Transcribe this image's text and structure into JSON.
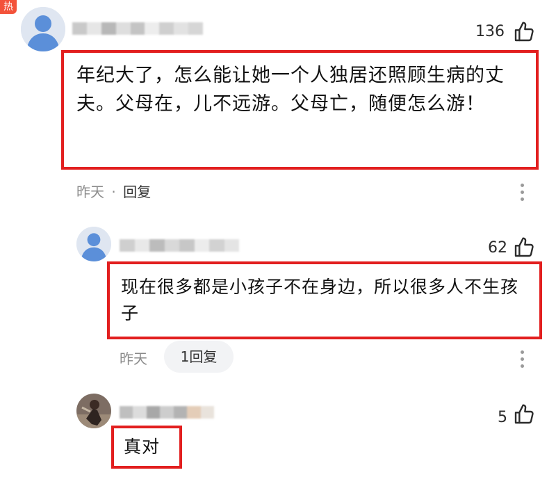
{
  "badge": {
    "label": "热"
  },
  "comments": [
    {
      "likes": "136",
      "text": "年纪大了，怎么能让她一个人独居还照顾生病的丈夫。父母在，儿不远游。父母亡，随便怎么游！",
      "time": "昨天",
      "separator": "·",
      "reply_label": "回复"
    },
    {
      "likes": "62",
      "text": "现在很多都是小孩子不在身边，所以很多人不生孩子",
      "time": "昨天",
      "reply_count_label": "1回复"
    },
    {
      "likes": "5",
      "text": "真对"
    }
  ],
  "icons": {
    "like": "thumbs-up-icon",
    "more": "more-vertical-icon",
    "avatar": "default-avatar-icon"
  },
  "colors": {
    "highlight_border": "#e21f1f",
    "hot_badge": "#f3523a",
    "meta_text": "#8a8a8a",
    "reply_pill_bg": "#f2f3f5"
  }
}
